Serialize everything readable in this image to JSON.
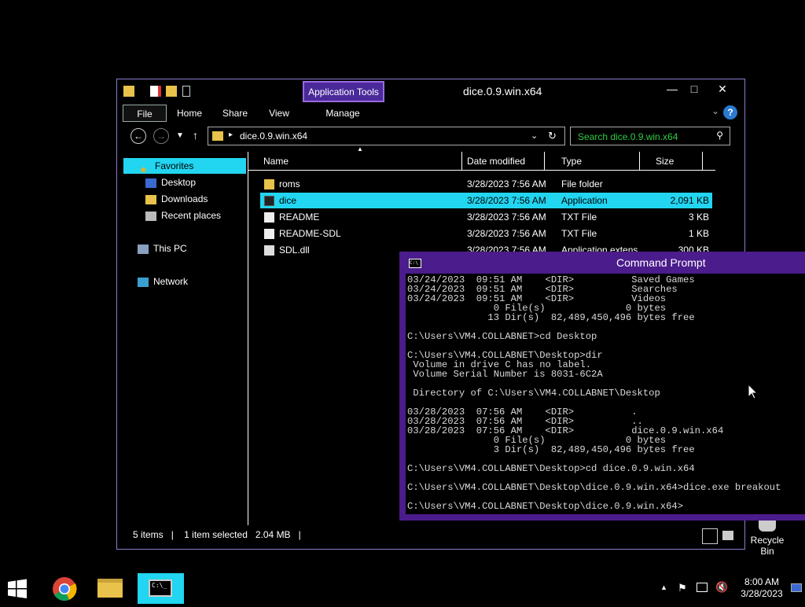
{
  "explorer": {
    "title": "dice.0.9.win.x64",
    "context_tab": "Application Tools",
    "tabs": [
      "File",
      "Home",
      "Share",
      "View",
      "Manage"
    ],
    "address": "dice.0.9.win.x64",
    "search_placeholder": "Search dice.0.9.win.x64",
    "nav": {
      "favorites": "Favorites",
      "desktop": "Desktop",
      "downloads": "Downloads",
      "recent": "Recent places",
      "this_pc": "This PC",
      "network": "Network"
    },
    "columns": [
      "Name",
      "Date modified",
      "Type",
      "Size"
    ],
    "files": [
      {
        "name": "roms",
        "date": "3/28/2023 7:56 AM",
        "type": "File folder",
        "size": ""
      },
      {
        "name": "dice",
        "date": "3/28/2023 7:56 AM",
        "type": "Application",
        "size": "2,091 KB"
      },
      {
        "name": "README",
        "date": "3/28/2023 7:56 AM",
        "type": "TXT File",
        "size": "3 KB"
      },
      {
        "name": "README-SDL",
        "date": "3/28/2023 7:56 AM",
        "type": "TXT File",
        "size": "1 KB"
      },
      {
        "name": "SDL.dll",
        "date": "3/28/2023 7:56 AM",
        "type": "Application extens...",
        "size": "300 KB"
      }
    ],
    "status": {
      "items": "5 items",
      "selected": "1 item selected",
      "size": "2.04 MB"
    }
  },
  "cmd": {
    "title": "Command Prompt",
    "lines": [
      "03/24/2023  09:51 AM    <DIR>          Saved Games",
      "03/24/2023  09:51 AM    <DIR>          Searches",
      "03/24/2023  09:51 AM    <DIR>          Videos",
      "               0 File(s)              0 bytes",
      "              13 Dir(s)  82,489,450,496 bytes free",
      "",
      "C:\\Users\\VM4.COLLABNET>cd Desktop",
      "",
      "C:\\Users\\VM4.COLLABNET\\Desktop>dir",
      " Volume in drive C has no label.",
      " Volume Serial Number is 8031-6C2A",
      "",
      " Directory of C:\\Users\\VM4.COLLABNET\\Desktop",
      "",
      "03/28/2023  07:56 AM    <DIR>          .",
      "03/28/2023  07:56 AM    <DIR>          ..",
      "03/28/2023  07:56 AM    <DIR>          dice.0.9.win.x64",
      "               0 File(s)              0 bytes",
      "               3 Dir(s)  82,489,450,496 bytes free",
      "",
      "C:\\Users\\VM4.COLLABNET\\Desktop>cd dice.0.9.win.x64",
      "",
      "C:\\Users\\VM4.COLLABNET\\Desktop\\dice.0.9.win.x64>dice.exe breakout",
      "",
      "C:\\Users\\VM4.COLLABNET\\Desktop\\dice.0.9.win.x64>"
    ]
  },
  "desktop": {
    "recycle_bin": "Recycle Bin"
  },
  "taskbar": {
    "time": "8:00 AM",
    "date": "3/28/2023"
  }
}
